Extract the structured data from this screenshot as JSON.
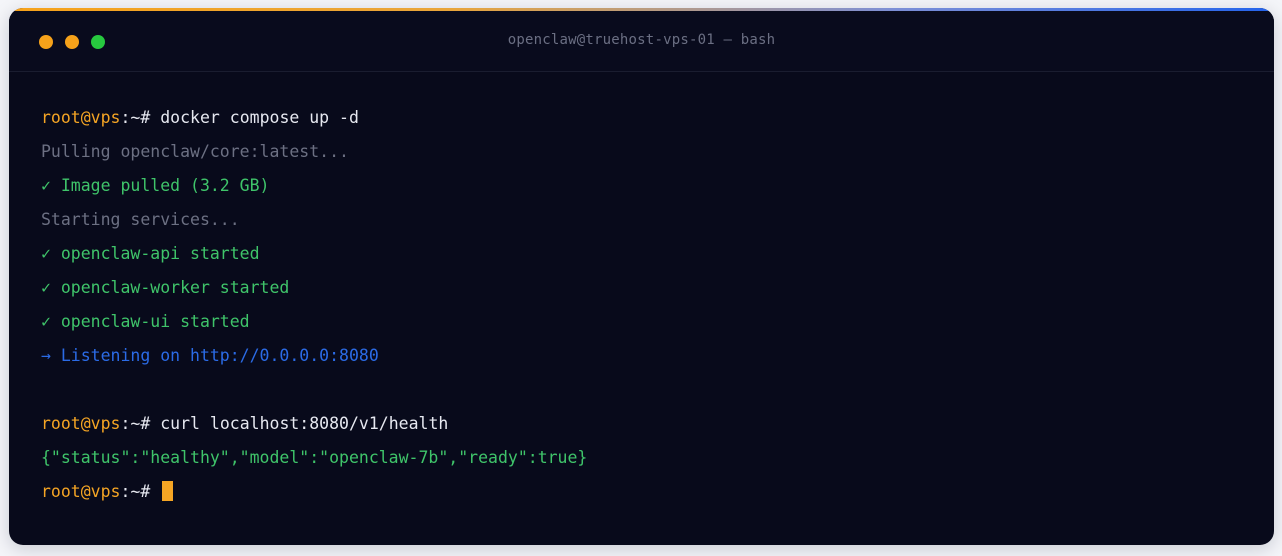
{
  "window": {
    "title": "openclaw@truehost-vps-01 — bash",
    "controls": [
      {
        "name": "close",
        "color": "#f6a21a"
      },
      {
        "name": "minimize",
        "color": "#f6a21a"
      },
      {
        "name": "zoom",
        "color": "#27c93f"
      }
    ]
  },
  "prompt": {
    "user_host": "root@vps",
    "separator": ":~# "
  },
  "lines": {
    "cmd1": "docker compose up -d",
    "pulling": "Pulling openclaw/core:latest...",
    "pulled": "✓ Image pulled (3.2 GB)",
    "starting": "Starting services...",
    "api": "✓ openclaw-api started",
    "worker": "✓ openclaw-worker started",
    "ui": "✓ openclaw-ui started",
    "listening": "→ Listening on http://0.0.0.0:8080",
    "cmd2": "curl localhost:8080/v1/health",
    "health": "{\"status\":\"healthy\",\"model\":\"openclaw-7b\",\"ready\":true}"
  },
  "colors": {
    "cursor": "#f5a524"
  }
}
